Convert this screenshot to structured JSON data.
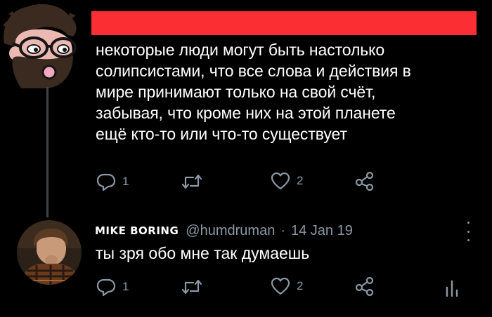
{
  "tweet1": {
    "text": "некоторые люди могут быть настолько\nсолипсистами, что все слова и действия в\nмире принимают только на свой счёт,\nзабывая, что кроме них на этой планете\nещё кто-то или что-то существует",
    "reply_count": "1",
    "like_count": "2",
    "redaction_color": "#fb2f33"
  },
  "tweet2": {
    "display_name": "MIKE BORING",
    "handle": "@humdruman",
    "separator": "·",
    "date": "14 Jan 19",
    "text": "ты зря обо мне так думаешь",
    "reply_count": "1",
    "like_count": "2"
  },
  "icons": {
    "reply": "reply-icon",
    "retweet": "retweet-icon",
    "like": "heart-icon",
    "share": "share-icon",
    "analytics": "analytics-icon",
    "more": "more-icon"
  },
  "colors": {
    "background": "#000000",
    "text": "#ffffff",
    "muted": "#8b98a5",
    "thread_line": "#3f4247"
  }
}
